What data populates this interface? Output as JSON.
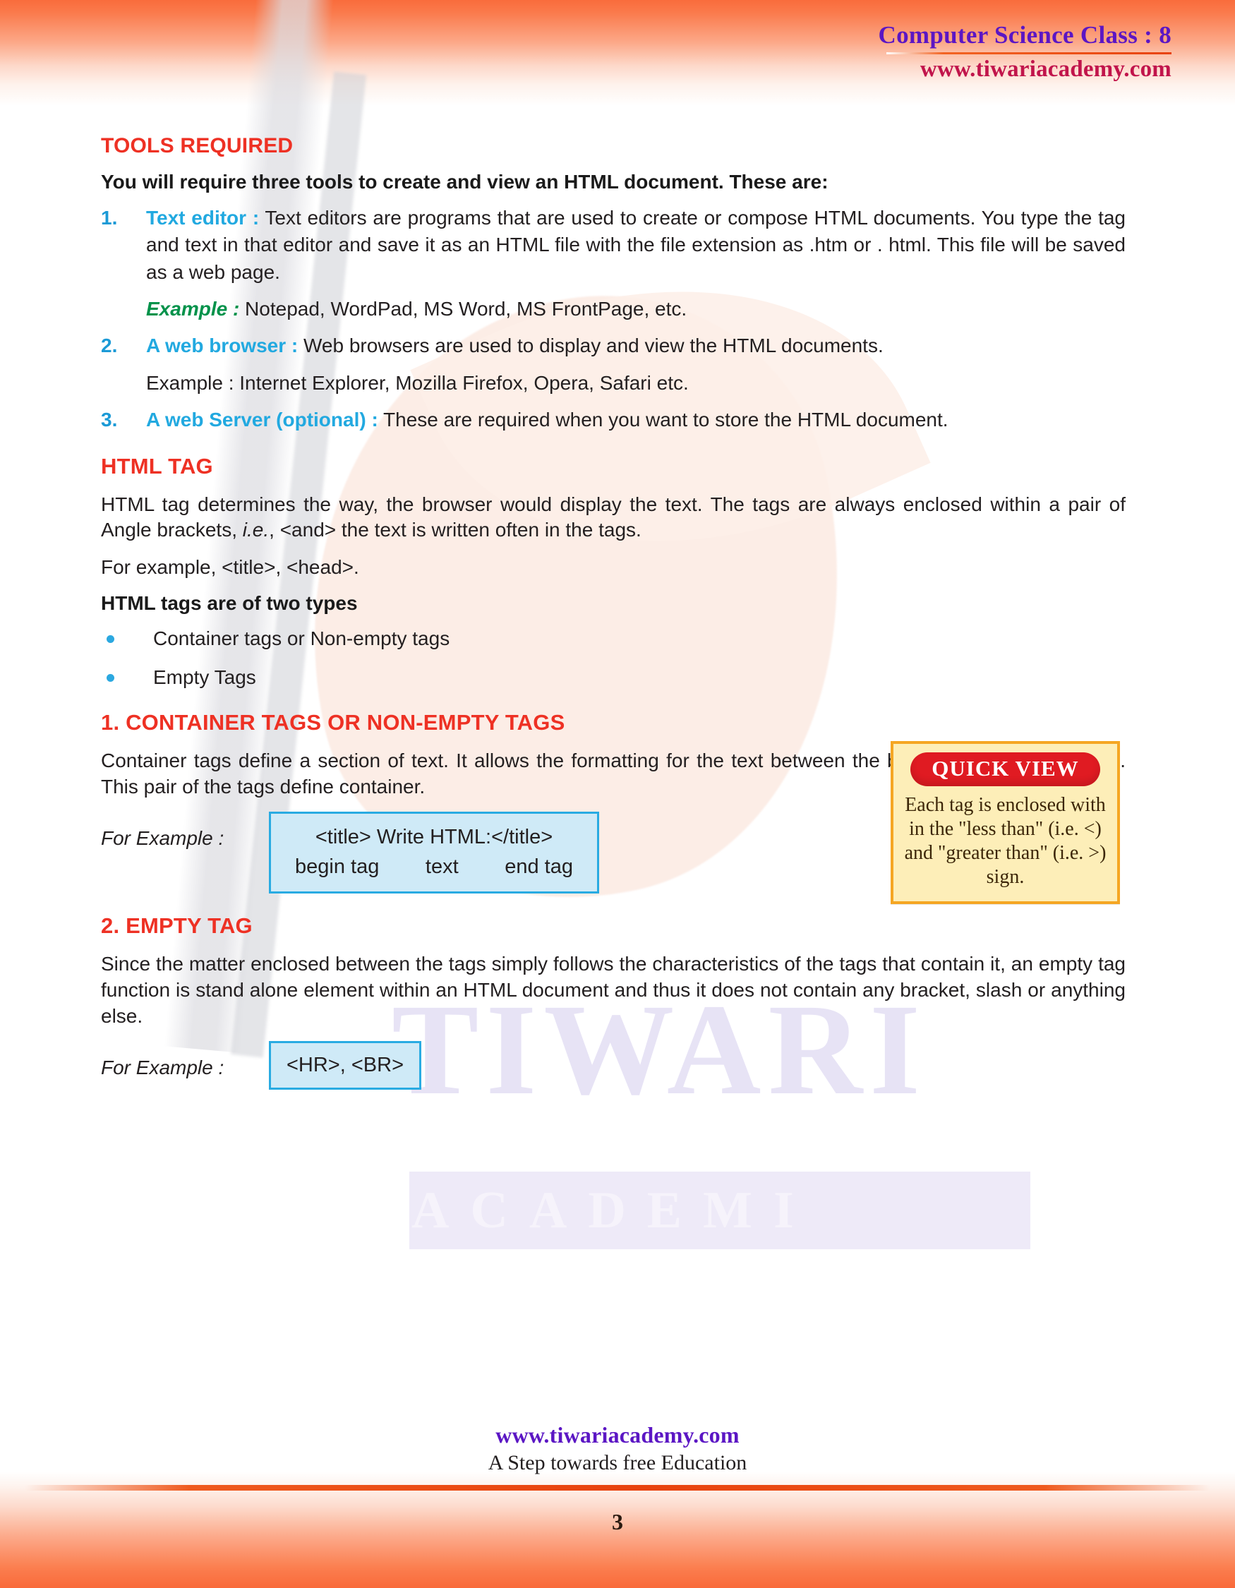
{
  "header": {
    "title": "Computer Science Class : 8",
    "site": "www.tiwariacademy.com"
  },
  "watermark": {
    "brand_top": "TIWARI",
    "brand_bottom": "ACADEMI"
  },
  "sections": {
    "tools": {
      "heading": "TOOLS REQUIRED",
      "intro": "You will require three tools to create and view an HTML document. These are:",
      "items": [
        {
          "num": "1.",
          "lead": "Text editor :",
          "text": " Text editors are programs that are used to create or compose HTML documents. You type the tag and text in that editor and save it as an HTML file with the file extension as .htm or . html. This file will be saved as a web page.",
          "example_lead": "Example :",
          "example_text": " Notepad, WordPad, MS Word, MS FrontPage, etc."
        },
        {
          "num": "2.",
          "lead": "A web browser :",
          "text": " Web browsers are used to display and view the HTML documents.",
          "example_text": "Example : Internet Explorer, Mozilla Firefox, Opera, Safari etc."
        },
        {
          "num": "3.",
          "lead": "A web Server (optional) :",
          "text": " These are required when you want to store the HTML document."
        }
      ]
    },
    "html_tag": {
      "heading": "HTML TAG",
      "p1_a": "HTML tag determines the way, the browser would display the text. The tags are always enclosed within a pair of Angle brackets, ",
      "p1_italic": "i.e.",
      "p1_b": ", <and> the text is written often in the tags.",
      "p2": "For example, <title>, <head>.",
      "p3_bold": "HTML tags are of two types",
      "bullets": [
        "Container tags or Non-empty tags",
        "Empty Tags"
      ]
    },
    "container_tags": {
      "heading": "1. CONTAINER TAGS OR NON-EMPTY TAGS",
      "p1": "Container tags define a section of text. It allows the formatting for the text between the begin tag and the end tag. This pair of the tags define container.",
      "example_label": "For Example :",
      "example_code": "<title>   Write HTML:</title>",
      "example_parts": {
        "begin": "begin tag",
        "text": "text",
        "end": "end tag"
      }
    },
    "empty_tag": {
      "heading": "2. EMPTY TAG",
      "p1": "Since the matter enclosed between the tags simply follows the characteristics of the tags that contain it, an empty tag function is stand alone element within an HTML document and thus it does not contain any bracket, slash or anything else.",
      "example_label": "For Example :",
      "example_code": "<HR>, <BR>"
    }
  },
  "quick_view": {
    "title": "QUICK VIEW",
    "body": "Each tag is enclosed with in the \"less than\" (i.e. <) and \"greater than\" (i.e. >) sign."
  },
  "footer": {
    "site": "www.tiwariacademy.com",
    "tagline": "A Step towards free Education",
    "page_number": "3"
  },
  "colors": {
    "heading_red": "#ee3124",
    "lead_blue": "#22a9e0",
    "lead_green": "#00924a",
    "brand_purple": "#5b16c4",
    "brand_crimson": "#c1144b",
    "box_border": "#29abe2",
    "box_fill": "#cfeaf7",
    "qv_border": "#f5a623",
    "qv_fill": "#fdeeb8",
    "qv_pill": "#e01b22",
    "page_orange": "#f96c3c"
  }
}
